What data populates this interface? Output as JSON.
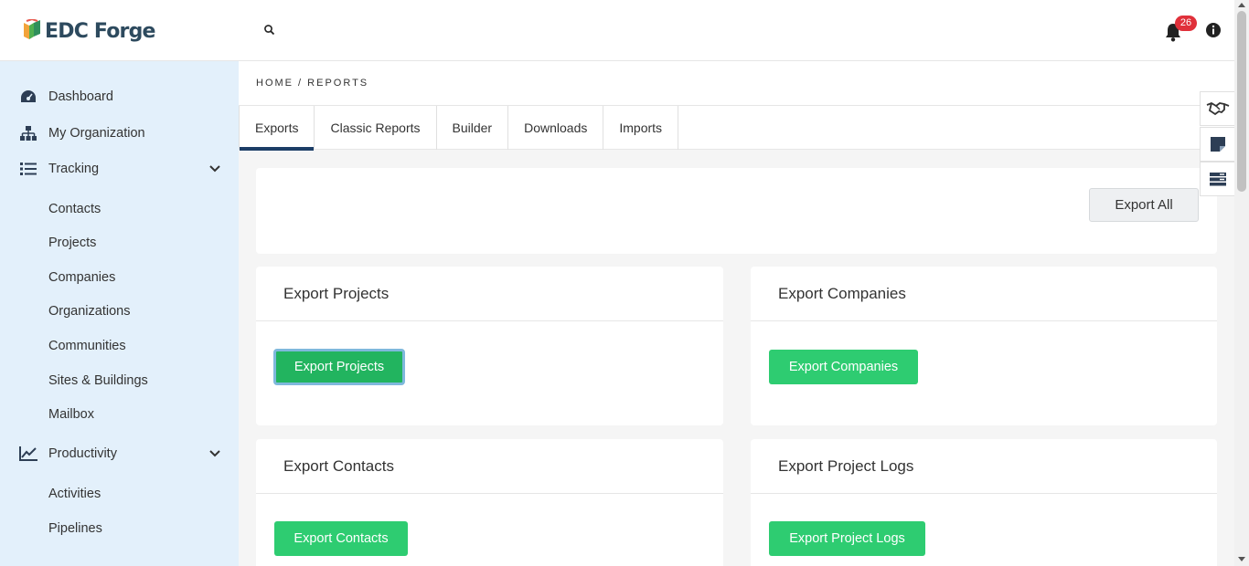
{
  "header": {
    "logo_text": "EDC Forge",
    "notification_count": "26"
  },
  "sidebar": {
    "items": [
      {
        "label": "Dashboard",
        "icon": "dashboard-icon"
      },
      {
        "label": "My Organization",
        "icon": "org-chart-icon"
      },
      {
        "label": "Tracking",
        "icon": "list-icon",
        "expanded": true
      },
      {
        "label": "Contacts"
      },
      {
        "label": "Projects"
      },
      {
        "label": "Companies"
      },
      {
        "label": "Organizations"
      },
      {
        "label": "Communities"
      },
      {
        "label": "Sites & Buildings"
      },
      {
        "label": "Mailbox"
      },
      {
        "label": "Productivity",
        "icon": "chart-line-icon",
        "expanded": true
      },
      {
        "label": "Activities"
      },
      {
        "label": "Pipelines"
      }
    ]
  },
  "breadcrumb": "HOME / REPORTS",
  "tabs": [
    {
      "label": "Exports",
      "active": true
    },
    {
      "label": "Classic Reports"
    },
    {
      "label": "Builder"
    },
    {
      "label": "Downloads"
    },
    {
      "label": "Imports"
    }
  ],
  "export_all_label": "Export All",
  "cards": {
    "projects": {
      "title": "Export Projects",
      "button": "Export Projects"
    },
    "companies": {
      "title": "Export Companies",
      "button": "Export Companies"
    },
    "contacts": {
      "title": "Export Contacts",
      "button": "Export Contacts"
    },
    "project_logs": {
      "title": "Export Project Logs",
      "button": "Export Project Logs"
    }
  },
  "colors": {
    "accent_green": "#2ecc71",
    "sidebar_bg": "#e3f0fb",
    "tab_active": "#1c3d66",
    "badge": "#e0303a"
  }
}
